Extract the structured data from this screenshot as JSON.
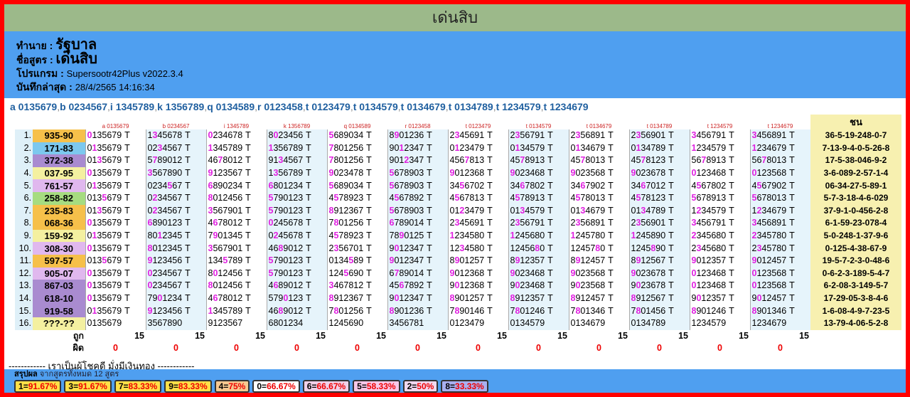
{
  "title": "เด่นสิบ",
  "info": {
    "predictor_label": "ทำนาย :",
    "predictor": "รัฐบาล",
    "formula_label": "ชื่อสูตร :",
    "formula": "เด่นสิบ",
    "program_label": "โปรแกรม :",
    "program": "Supersootr42Plus v2022.3.4",
    "saved_label": "บันทึกล่าสุด :",
    "saved": "28/4/2565 14:16:34"
  },
  "filters": [
    "a 0135679",
    "b 0234567",
    "i 1345789",
    "k 1356789",
    "q 0134589",
    "r 0123458",
    "t 0123479",
    "t 0134579",
    "t 0134679",
    "t 0134789",
    "t 1234579",
    "t 1234679"
  ],
  "columns": [
    "a 0135679",
    "b 0234567",
    "i 1345789",
    "k 1356789",
    "q 0134589",
    "r 0123458",
    "t 0123479",
    "t 0134579",
    "t 0134679",
    "t 0134789",
    "t 1234579",
    "t 1234679"
  ],
  "chon_header": "ชน",
  "rows": [
    {
      "n": "1.",
      "result": "935-90",
      "color": "#f6c04a",
      "cells": [
        "0135679 T",
        "1345678 T",
        "0234678 T",
        "8023456 T",
        "5689034 T",
        "8901236 T",
        "2345691 T",
        "2356791 T",
        "2356891 T",
        "2356901 T",
        "3456791 T",
        "3456891 T"
      ],
      "chon": "36-5-19-248-0-7"
    },
    {
      "n": "2.",
      "result": "171-83",
      "color": "#7cc8ee",
      "cells": [
        "0135679 T",
        "0234567 T",
        "1345789 T",
        "1356789 T",
        "7801256 T",
        "9012347 T",
        "0123479 T",
        "0134579 T",
        "0134679 T",
        "0134789 T",
        "1234579 T",
        "1234679 T"
      ],
      "chon": "7-13-9-4-0-5-26-8"
    },
    {
      "n": "3.",
      "result": "372-38",
      "color": "#a98bd0",
      "cells": [
        "0135679 T",
        "5789012 T",
        "4678012 T",
        "9134567 T",
        "7801256 T",
        "9012347 T",
        "4567813 T",
        "4578913 T",
        "4578013 T",
        "4578123 T",
        "5678913 T",
        "5678013 T"
      ],
      "chon": "17-5-38-046-9-2"
    },
    {
      "n": "4.",
      "result": "037-95",
      "color": "#f4f0a0",
      "cells": [
        "0135679 T",
        "3567890 T",
        "9123567 T",
        "1356789 T",
        "9023478 T",
        "5678903 T",
        "9012368 T",
        "9023468 T",
        "9023568 T",
        "9023678 T",
        "0123468 T",
        "0123568 T"
      ],
      "chon": "3-6-089-2-57-1-4"
    },
    {
      "n": "5.",
      "result": "761-57",
      "color": "#e0b8ee",
      "cells": [
        "0135679 T",
        "0234567 T",
        "6890234 T",
        "6801234 T",
        "5689034 T",
        "5678903 T",
        "3456702 T",
        "3467802 T",
        "3467902 T",
        "3467012 T",
        "4567802 T",
        "4567902 T"
      ],
      "chon": "06-34-27-5-89-1"
    },
    {
      "n": "6.",
      "result": "258-82",
      "color": "#a6dc80",
      "cells": [
        "0135679 T",
        "0234567 T",
        "8012456 T",
        "5790123 T",
        "4578923 T",
        "4567892 T",
        "4567813 T",
        "4578913 T",
        "4578013 T",
        "4578123 T",
        "5678913 T",
        "5678013 T"
      ],
      "chon": "5-7-3-18-4-6-029"
    },
    {
      "n": "7.",
      "result": "235-83",
      "color": "#f6c04a",
      "cells": [
        "0135679 T",
        "0234567 T",
        "3567901 T",
        "5790123 T",
        "8912367 T",
        "5678903 T",
        "0123479 T",
        "0134579 T",
        "0134679 T",
        "0134789 T",
        "1234579 T",
        "1234679 T"
      ],
      "chon": "37-9-1-0-456-2-8"
    },
    {
      "n": "8.",
      "result": "068-36",
      "color": "#f6c04a",
      "cells": [
        "0135679 T",
        "6890123 T",
        "4678012 T",
        "0245678 T",
        "7801256 T",
        "6789014 T",
        "2345691 T",
        "2356791 T",
        "2356891 T",
        "2356901 T",
        "3456791 T",
        "3456891 T"
      ],
      "chon": "6-1-59-23-078-4"
    },
    {
      "n": "9.",
      "result": "159-92",
      "color": "#f4f0a0",
      "cells": [
        "0135679 T",
        "8012345 T",
        "7901345 T",
        "0245678 T",
        "4578923 T",
        "7890125 T",
        "1234580 T",
        "1245680 T",
        "1245780 T",
        "1245890 T",
        "2345680 T",
        "2345780 T"
      ],
      "chon": "5-0-248-1-37-9-6"
    },
    {
      "n": "10.",
      "result": "308-30",
      "color": "#e0b8ee",
      "cells": [
        "0135679 T",
        "8012345 T",
        "3567901 T",
        "4689012 T",
        "2356701 T",
        "9012347 T",
        "1234580 T",
        "1245680 T",
        "1245780 T",
        "1245890 T",
        "2345680 T",
        "2345780 T"
      ],
      "chon": "0-125-4-38-67-9"
    },
    {
      "n": "11.",
      "result": "597-57",
      "color": "#f6c04a",
      "cells": [
        "0135679 T",
        "9123456 T",
        "1345789 T",
        "5790123 T",
        "0134589 T",
        "9012347 T",
        "8901257 T",
        "8912357 T",
        "8912457 T",
        "8912567 T",
        "9012357 T",
        "9012457 T"
      ],
      "chon": "19-5-7-2-3-0-48-6"
    },
    {
      "n": "12.",
      "result": "905-07",
      "color": "#e0b8ee",
      "cells": [
        "0135679 T",
        "0234567 T",
        "8012456 T",
        "5790123 T",
        "1245690 T",
        "6789014 T",
        "9012368 T",
        "9023468 T",
        "9023568 T",
        "9023678 T",
        "0123468 T",
        "0123568 T"
      ],
      "chon": "0-6-2-3-189-5-4-7"
    },
    {
      "n": "13.",
      "result": "867-03",
      "color": "#a98bd0",
      "cells": [
        "0135679 T",
        "0234567 T",
        "8012456 T",
        "4689012 T",
        "3467812 T",
        "4567892 T",
        "9012368 T",
        "9023468 T",
        "9023568 T",
        "9023678 T",
        "0123468 T",
        "0123568 T"
      ],
      "chon": "6-2-08-3-149-5-7"
    },
    {
      "n": "14.",
      "result": "618-10",
      "color": "#a98bd0",
      "cells": [
        "0135679 T",
        "7901234 T",
        "4678012 T",
        "5790123 T",
        "8912367 T",
        "9012347 T",
        "8901257 T",
        "8912357 T",
        "8912457 T",
        "8912567 T",
        "9012357 T",
        "9012457 T"
      ],
      "chon": "17-29-05-3-8-4-6"
    },
    {
      "n": "15.",
      "result": "919-58",
      "color": "#a98bd0",
      "cells": [
        "0135679 T",
        "9123456 T",
        "1345789 T",
        "4689012 T",
        "7801256 T",
        "8901236 T",
        "7890146 T",
        "7801246 T",
        "7801346 T",
        "7801456 T",
        "8901246 T",
        "8901346 T"
      ],
      "chon": "1-6-08-4-9-7-23-5"
    },
    {
      "n": "16.",
      "result": "???-??",
      "color": "#f4f0a0",
      "cells": [
        "0135679",
        "3567890",
        "9123567",
        "6801234",
        "1245690",
        "3456781",
        "0123479",
        "0134579",
        "0134679",
        "0134789",
        "1234579",
        "1234679"
      ],
      "chon": "13-79-4-06-5-2-8"
    }
  ],
  "hit_label": "ถูก",
  "miss_label": "ผิด",
  "hits": [
    "15",
    "15",
    "15",
    "15",
    "15",
    "15",
    "15",
    "15",
    "15",
    "15",
    "15",
    "15"
  ],
  "misses": [
    "0",
    "0",
    "0",
    "0",
    "0",
    "0",
    "0",
    "0",
    "0",
    "0",
    "0",
    "0"
  ],
  "footer_text": "------------ เราเป็นผู้โชคดี มั่งมีเงินทอง ------------",
  "summary": {
    "label": "สรุปผล",
    "subtitle": "จากสูตรทั้งหมด 12 สูตร",
    "badges": [
      {
        "digit": "1",
        "pct": "91.67%",
        "bg": "#ffe048"
      },
      {
        "digit": "3",
        "pct": "91.67%",
        "bg": "#ffe048"
      },
      {
        "digit": "7",
        "pct": "83.33%",
        "bg": "#ffe048"
      },
      {
        "digit": "9",
        "pct": "83.33%",
        "bg": "#ffe048"
      },
      {
        "digit": "4",
        "pct": "75%",
        "bg": "#f6c890"
      },
      {
        "digit": "0",
        "pct": "66.67%",
        "bg": "#ffffff"
      },
      {
        "digit": "6",
        "pct": "66.67%",
        "bg": "#f0d0e8"
      },
      {
        "digit": "5",
        "pct": "58.33%",
        "bg": "#f8c8e8"
      },
      {
        "digit": "2",
        "pct": "50%",
        "bg": "#f0d8f0"
      },
      {
        "digit": "8",
        "pct": "33.33%",
        "bg": "#a8b0f0"
      }
    ]
  }
}
